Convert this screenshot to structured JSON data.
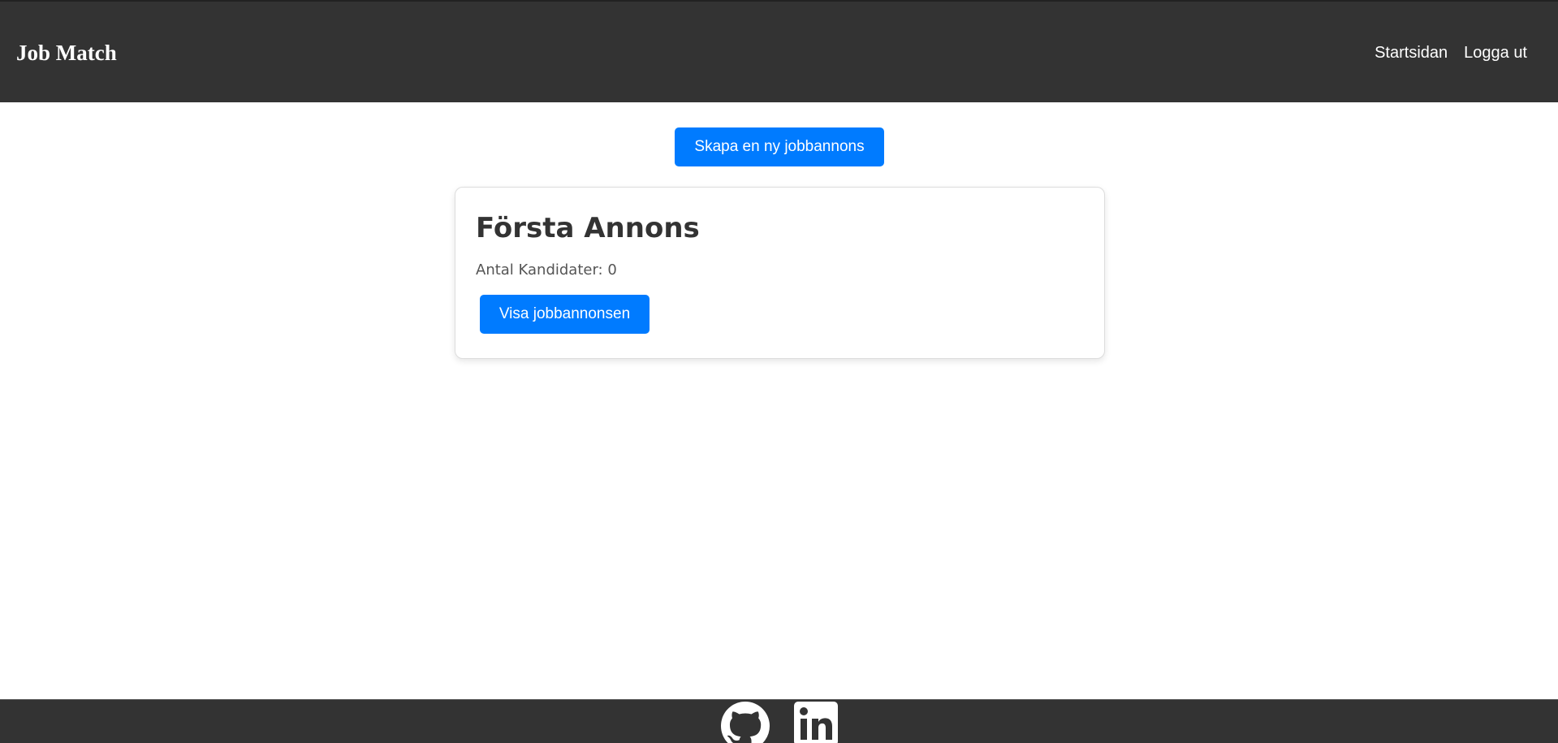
{
  "navbar": {
    "brand": "Job Match",
    "links": [
      {
        "label": "Startsidan"
      },
      {
        "label": "Logga ut"
      }
    ]
  },
  "main": {
    "create_button_label": "Skapa en ny jobbannons",
    "job_cards": [
      {
        "title": "Första Annons",
        "candidates_text": "Antal Kandidater: 0",
        "view_button_label": "Visa jobbannonsen"
      }
    ]
  },
  "footer": {
    "icons": [
      "github-icon",
      "linkedin-icon"
    ]
  },
  "colors": {
    "navbar_bg": "#333333",
    "accent": "#007bff",
    "text_dark": "#333333"
  }
}
